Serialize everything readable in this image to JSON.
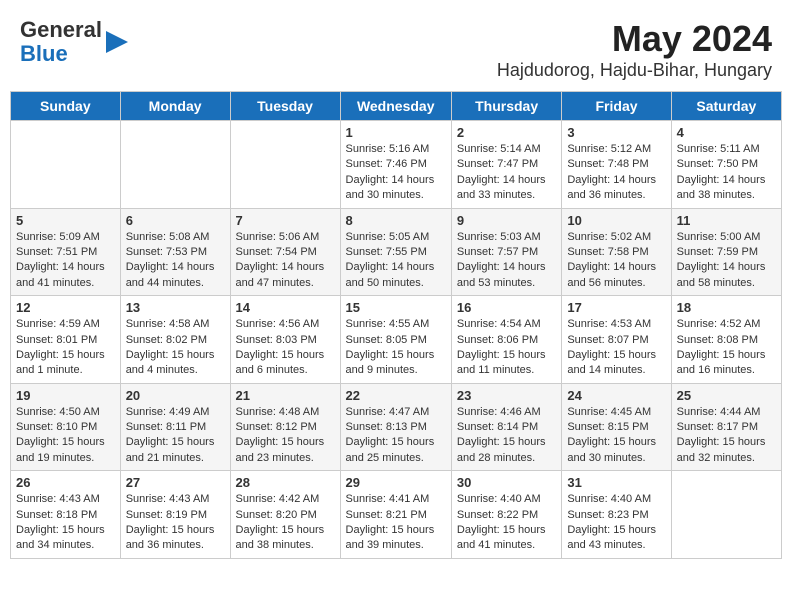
{
  "header": {
    "logo_general": "General",
    "logo_blue": "Blue",
    "title": "May 2024",
    "subtitle": "Hajdudorog, Hajdu-Bihar, Hungary"
  },
  "days_of_week": [
    "Sunday",
    "Monday",
    "Tuesday",
    "Wednesday",
    "Thursday",
    "Friday",
    "Saturday"
  ],
  "weeks": [
    [
      {
        "day": "",
        "content": ""
      },
      {
        "day": "",
        "content": ""
      },
      {
        "day": "",
        "content": ""
      },
      {
        "day": "1",
        "content": "Sunrise: 5:16 AM\nSunset: 7:46 PM\nDaylight: 14 hours and 30 minutes."
      },
      {
        "day": "2",
        "content": "Sunrise: 5:14 AM\nSunset: 7:47 PM\nDaylight: 14 hours and 33 minutes."
      },
      {
        "day": "3",
        "content": "Sunrise: 5:12 AM\nSunset: 7:48 PM\nDaylight: 14 hours and 36 minutes."
      },
      {
        "day": "4",
        "content": "Sunrise: 5:11 AM\nSunset: 7:50 PM\nDaylight: 14 hours and 38 minutes."
      }
    ],
    [
      {
        "day": "5",
        "content": "Sunrise: 5:09 AM\nSunset: 7:51 PM\nDaylight: 14 hours and 41 minutes."
      },
      {
        "day": "6",
        "content": "Sunrise: 5:08 AM\nSunset: 7:53 PM\nDaylight: 14 hours and 44 minutes."
      },
      {
        "day": "7",
        "content": "Sunrise: 5:06 AM\nSunset: 7:54 PM\nDaylight: 14 hours and 47 minutes."
      },
      {
        "day": "8",
        "content": "Sunrise: 5:05 AM\nSunset: 7:55 PM\nDaylight: 14 hours and 50 minutes."
      },
      {
        "day": "9",
        "content": "Sunrise: 5:03 AM\nSunset: 7:57 PM\nDaylight: 14 hours and 53 minutes."
      },
      {
        "day": "10",
        "content": "Sunrise: 5:02 AM\nSunset: 7:58 PM\nDaylight: 14 hours and 56 minutes."
      },
      {
        "day": "11",
        "content": "Sunrise: 5:00 AM\nSunset: 7:59 PM\nDaylight: 14 hours and 58 minutes."
      }
    ],
    [
      {
        "day": "12",
        "content": "Sunrise: 4:59 AM\nSunset: 8:01 PM\nDaylight: 15 hours and 1 minute."
      },
      {
        "day": "13",
        "content": "Sunrise: 4:58 AM\nSunset: 8:02 PM\nDaylight: 15 hours and 4 minutes."
      },
      {
        "day": "14",
        "content": "Sunrise: 4:56 AM\nSunset: 8:03 PM\nDaylight: 15 hours and 6 minutes."
      },
      {
        "day": "15",
        "content": "Sunrise: 4:55 AM\nSunset: 8:05 PM\nDaylight: 15 hours and 9 minutes."
      },
      {
        "day": "16",
        "content": "Sunrise: 4:54 AM\nSunset: 8:06 PM\nDaylight: 15 hours and 11 minutes."
      },
      {
        "day": "17",
        "content": "Sunrise: 4:53 AM\nSunset: 8:07 PM\nDaylight: 15 hours and 14 minutes."
      },
      {
        "day": "18",
        "content": "Sunrise: 4:52 AM\nSunset: 8:08 PM\nDaylight: 15 hours and 16 minutes."
      }
    ],
    [
      {
        "day": "19",
        "content": "Sunrise: 4:50 AM\nSunset: 8:10 PM\nDaylight: 15 hours and 19 minutes."
      },
      {
        "day": "20",
        "content": "Sunrise: 4:49 AM\nSunset: 8:11 PM\nDaylight: 15 hours and 21 minutes."
      },
      {
        "day": "21",
        "content": "Sunrise: 4:48 AM\nSunset: 8:12 PM\nDaylight: 15 hours and 23 minutes."
      },
      {
        "day": "22",
        "content": "Sunrise: 4:47 AM\nSunset: 8:13 PM\nDaylight: 15 hours and 25 minutes."
      },
      {
        "day": "23",
        "content": "Sunrise: 4:46 AM\nSunset: 8:14 PM\nDaylight: 15 hours and 28 minutes."
      },
      {
        "day": "24",
        "content": "Sunrise: 4:45 AM\nSunset: 8:15 PM\nDaylight: 15 hours and 30 minutes."
      },
      {
        "day": "25",
        "content": "Sunrise: 4:44 AM\nSunset: 8:17 PM\nDaylight: 15 hours and 32 minutes."
      }
    ],
    [
      {
        "day": "26",
        "content": "Sunrise: 4:43 AM\nSunset: 8:18 PM\nDaylight: 15 hours and 34 minutes."
      },
      {
        "day": "27",
        "content": "Sunrise: 4:43 AM\nSunset: 8:19 PM\nDaylight: 15 hours and 36 minutes."
      },
      {
        "day": "28",
        "content": "Sunrise: 4:42 AM\nSunset: 8:20 PM\nDaylight: 15 hours and 38 minutes."
      },
      {
        "day": "29",
        "content": "Sunrise: 4:41 AM\nSunset: 8:21 PM\nDaylight: 15 hours and 39 minutes."
      },
      {
        "day": "30",
        "content": "Sunrise: 4:40 AM\nSunset: 8:22 PM\nDaylight: 15 hours and 41 minutes."
      },
      {
        "day": "31",
        "content": "Sunrise: 4:40 AM\nSunset: 8:23 PM\nDaylight: 15 hours and 43 minutes."
      },
      {
        "day": "",
        "content": ""
      }
    ]
  ]
}
